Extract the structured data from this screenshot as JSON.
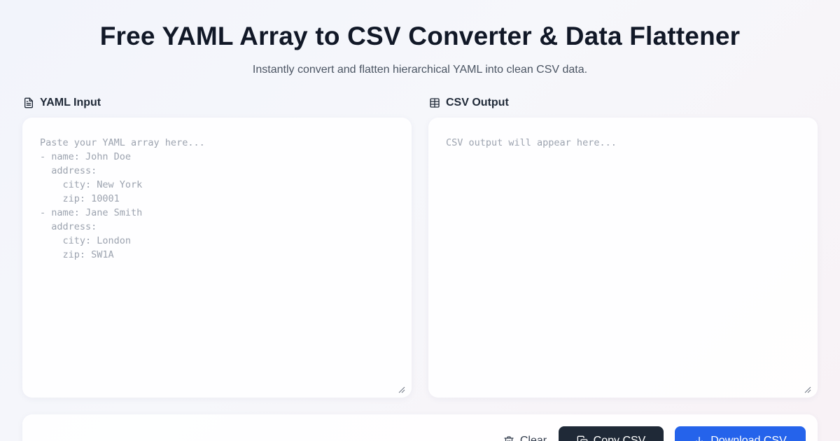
{
  "header": {
    "title": "Free YAML Array to CSV Converter & Data Flattener",
    "subtitle": "Instantly convert and flatten hierarchical YAML into clean CSV data."
  },
  "input_panel": {
    "label": "YAML Input",
    "icon": "file-text-icon",
    "placeholder": "Paste your YAML array here...\n- name: John Doe\n  address:\n    city: New York\n    zip: 10001\n- name: Jane Smith\n  address:\n    city: London\n    zip: SW1A",
    "value": ""
  },
  "output_panel": {
    "label": "CSV Output",
    "icon": "table-icon",
    "placeholder": "CSV output will appear here...",
    "value": ""
  },
  "actions": {
    "clear_label": "Clear",
    "clear_icon": "trash-icon",
    "copy_label": "Copy CSV",
    "copy_icon": "copy-icon",
    "download_label": "Download CSV",
    "download_icon": "download-icon"
  },
  "colors": {
    "primary": "#2563eb",
    "dark_button": "#1f2937",
    "title": "#111827",
    "subtitle": "#4b5563"
  }
}
